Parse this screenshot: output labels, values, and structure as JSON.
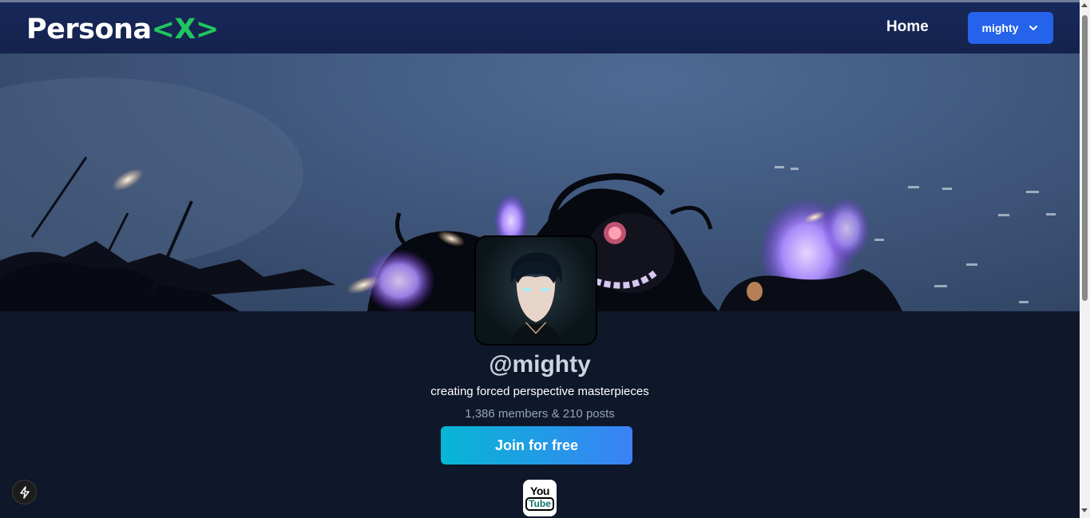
{
  "brand": {
    "name": "Persona",
    "accent": "<X>",
    "accent_color": "#22c55e"
  },
  "nav": {
    "home_label": "Home",
    "user_label": "mighty",
    "user_button_color": "#2563eb"
  },
  "profile": {
    "handle": "@mighty",
    "bio": "creating forced perspective masterpieces",
    "stats": "1,386 members & 210 posts",
    "join_label": "Join for free"
  },
  "social": {
    "youtube_top": "You",
    "youtube_bottom": "Tube"
  },
  "icons": {
    "user_menu": "chevron-down-icon",
    "social": "youtube-icon",
    "dev": "lightning-bolt-icon"
  }
}
